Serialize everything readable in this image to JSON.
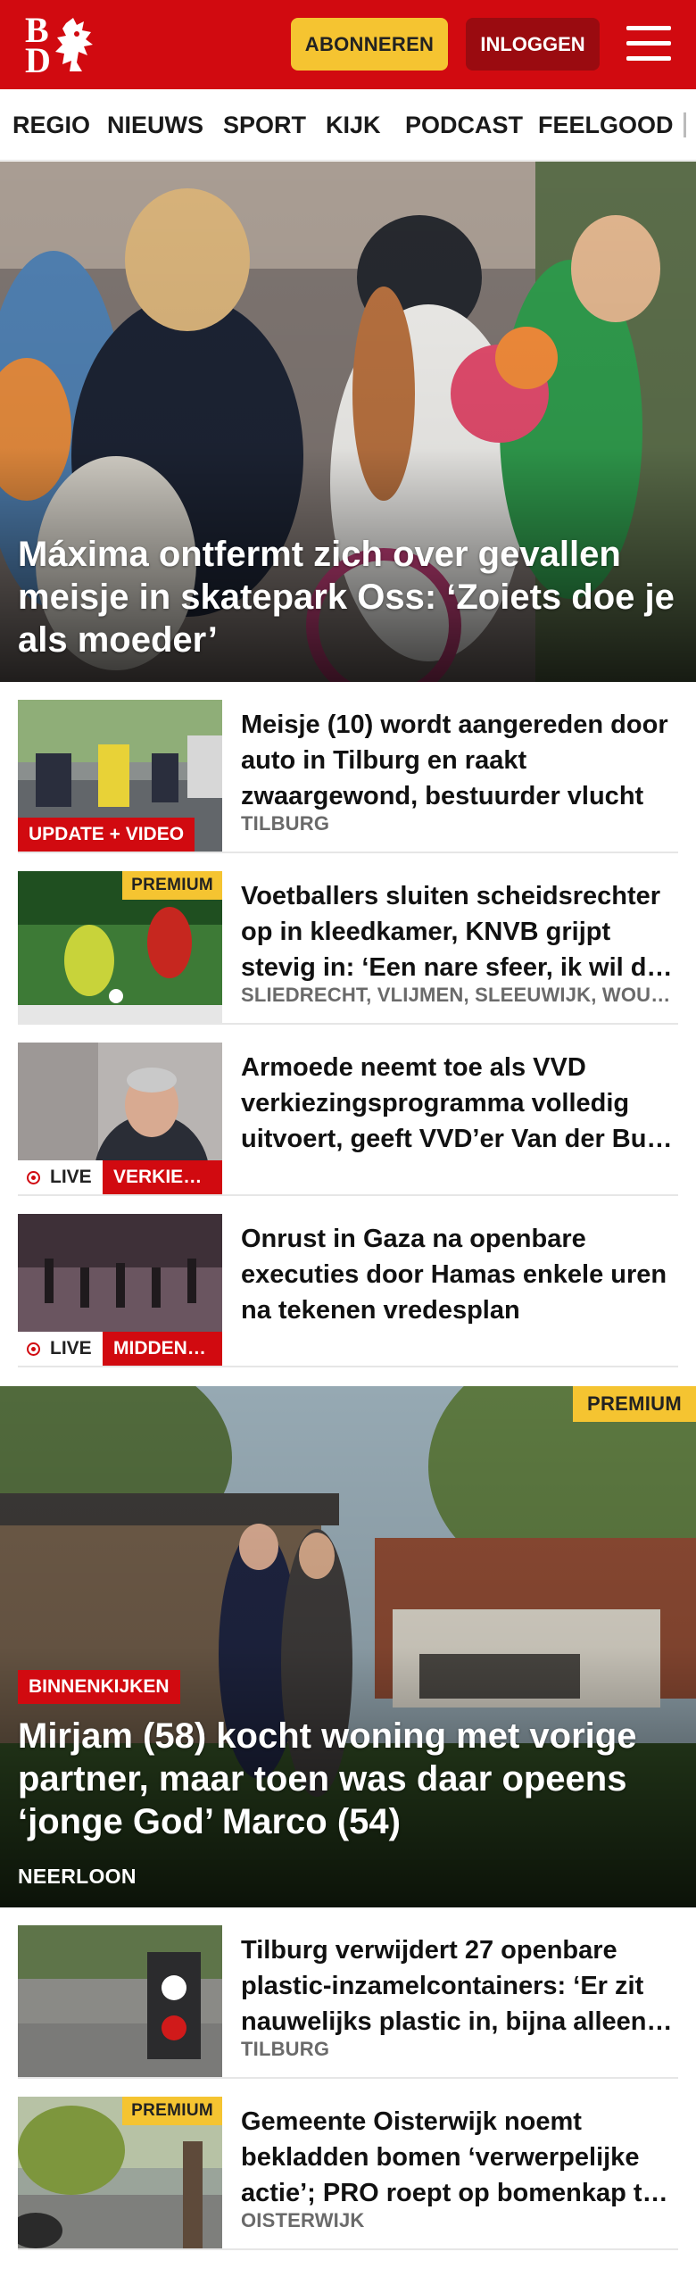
{
  "header": {
    "logo_top": "B",
    "logo_bottom": "D",
    "subscribe_label": "ABONNEREN",
    "login_label": "INLOGGEN",
    "colors": {
      "brand": "#d10a10",
      "subscribe": "#f5c431",
      "login": "#9a0b10"
    }
  },
  "nav": {
    "items": [
      "REGIO",
      "NIEUWS",
      "SPORT",
      "KIJK",
      "PODCAST",
      "FEELGOOD"
    ]
  },
  "hero": {
    "title": "Máxima ontfermt zich over gevallen meisje in skatepark Oss: ‘Zoiets doe je als moeder’"
  },
  "articles": [
    {
      "title": "Meisje (10) wordt aangereden door auto in Tilburg en raakt zwaargewond, bestuurder vlucht",
      "location": "TILBURG",
      "tag": "UPDATE + VIDEO"
    },
    {
      "title": "Voetballers sluiten scheidsrechter op in kleedkamer, KNVB grijpt stevig in: ‘Een nare sfeer, ik wil dit nooit meer meemaken’",
      "location": "SLIEDRECHT, VLIJMEN, SLEEUWIJK, WOUDRICHEM",
      "premium": "PREMIUM"
    },
    {
      "title": "Armoede neemt toe als VVD verkiezingsprogramma volledig uitvoert, geeft VVD’er Van der Burg toe",
      "live": "LIVE",
      "tag": "VERKIEZINGEN"
    },
    {
      "title": "Onrust in Gaza na openbare executies door Hamas enkele uren na tekenen vredesplan",
      "live": "LIVE",
      "tag": "MIDDEN-OOSTEN"
    }
  ],
  "feature": {
    "premium": "PREMIUM",
    "tag": "BINNENKIJKEN",
    "title": "Mirjam (58) kocht woning met vorige partner, maar toen was daar opeens ‘jonge God’ Marco (54)",
    "location": "NEERLOON"
  },
  "articles2": [
    {
      "title": "Tilburg verwijdert 27 openbare plastic-inzamelcontainers: ‘Er zit nauwelijks plastic in, bijna alleen restafval’",
      "location": "TILBURG"
    },
    {
      "title": "Gemeente Oisterwijk noemt bekladden bomen ‘verwerpelijke actie’; PRO roept op bomenkap te stoppen",
      "location": "OISTERWIJK",
      "premium": "PREMIUM"
    }
  ]
}
